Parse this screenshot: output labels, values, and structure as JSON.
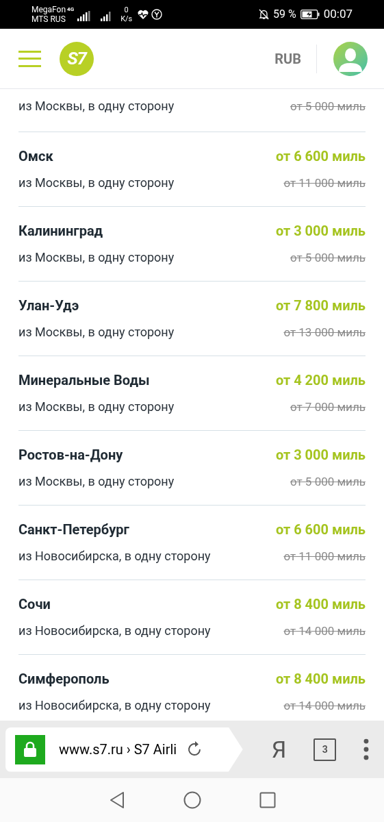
{
  "status_bar": {
    "carrier_1": "MegaFon",
    "network_1": "4G",
    "carrier_2": "MTS RUS",
    "speed_value": "0",
    "speed_unit": "K/s",
    "battery": "59 %",
    "time": "00:07"
  },
  "header": {
    "logo": "S7",
    "currency": "RUB"
  },
  "offers": [
    {
      "subtitle": "из Москвы, в одну сторону",
      "old_price": "от 5 000 миль"
    },
    {
      "title": "Омск",
      "subtitle": "из Москвы, в одну сторону",
      "price": "от 6 600 миль",
      "old_price": "от 11 000 миль"
    },
    {
      "title": "Калининград",
      "subtitle": "из Москвы, в одну сторону",
      "price": "от 3 000 миль",
      "old_price": "от 5 000 миль"
    },
    {
      "title": "Улан-Удэ",
      "subtitle": "из Москвы, в одну сторону",
      "price": "от 7 800 миль",
      "old_price": "от 13 000 миль"
    },
    {
      "title": "Минеральные Воды",
      "subtitle": "из Москвы, в одну сторону",
      "price": "от 4 200 миль",
      "old_price": "от 7 000 миль"
    },
    {
      "title": "Ростов-на-Дону",
      "subtitle": "из Москвы, в одну сторону",
      "price": "от 3 000 миль",
      "old_price": "от 5 000 миль"
    },
    {
      "title": "Санкт-Петербург",
      "subtitle": "из Новосибирска, в одну сторону",
      "price": "от 6 600 миль",
      "old_price": "от 11 000 миль"
    },
    {
      "title": "Сочи",
      "subtitle": "из Новосибирска, в одну сторону",
      "price": "от 8 400 миль",
      "old_price": "от 14 000 миль"
    },
    {
      "title": "Симферополь",
      "subtitle": "из Новосибирска, в одну сторону",
      "price": "от 8 400 миль",
      "old_price": "от 14 000 миль"
    }
  ],
  "browser_bar": {
    "url": "www.s7.ru › S7 Airli",
    "yandex": "Я",
    "tabs_count": "3"
  }
}
